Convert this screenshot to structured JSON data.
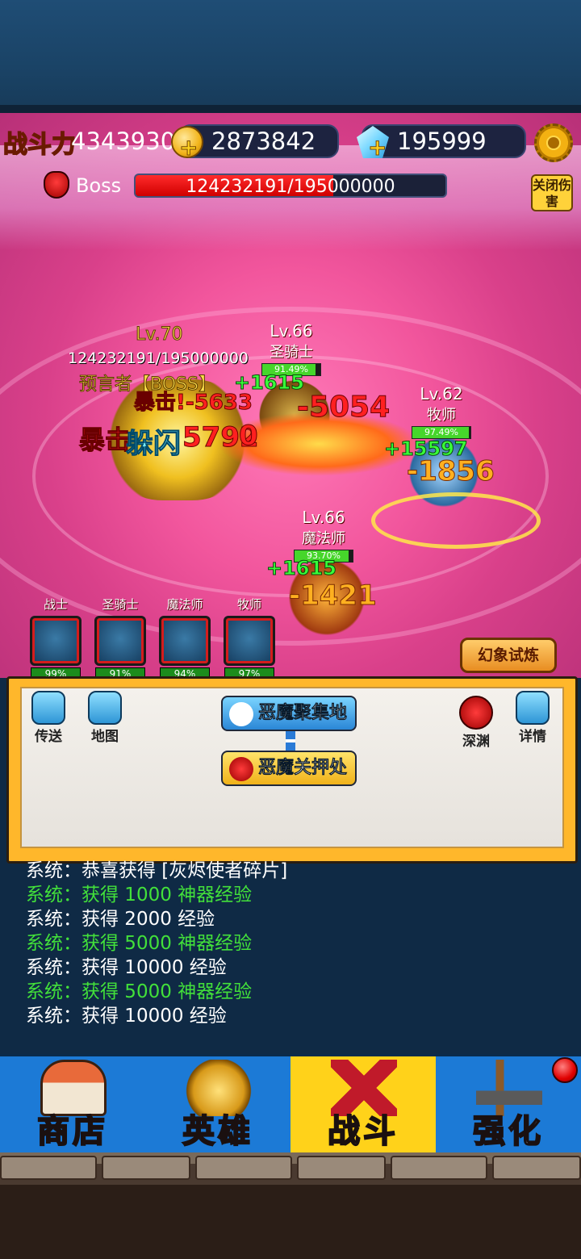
{
  "header": {
    "power_label": "战斗力",
    "power_value": "4343930",
    "gold": "2873842",
    "gems": "195999",
    "plus_glyph": "+",
    "gear_icon": "gear-icon"
  },
  "boss_bar": {
    "label": "Boss",
    "hp_text": "124232191/195000000",
    "hp_fraction": 0.637,
    "close_damage_label": "关闭伤害"
  },
  "battle": {
    "boss": {
      "level": "Lv.70",
      "hp_text": "124232191/195000000",
      "name": "预言者【BOSS】"
    },
    "units": [
      {
        "level": "Lv.66",
        "class": "圣骑士",
        "hp_pct": "91.49%",
        "hp_fraction": 0.9149
      },
      {
        "level": "Lv.62",
        "class": "牧师",
        "hp_pct": "97.49%",
        "hp_fraction": 0.9749
      },
      {
        "level": "Lv.66",
        "class": "魔法师",
        "hp_pct": "93.70%",
        "hp_fraction": 0.937
      }
    ],
    "floating_texts": {
      "crit1": "暴击!-5633",
      "big_red": "-5054",
      "heal1": "+1615",
      "dodge": "躲闪",
      "crit2": "暴击",
      "num2": "5792",
      "num3": "0",
      "heal2": "+15597",
      "orange1": "-1856",
      "heal3": "+1615",
      "orange2": "-1421"
    }
  },
  "party": [
    {
      "name": "战士",
      "pct": "99%"
    },
    {
      "name": "圣骑士",
      "pct": "91%"
    },
    {
      "name": "魔法师",
      "pct": "94%"
    },
    {
      "name": "牧师",
      "pct": "97%"
    }
  ],
  "illusion_button": "幻象试炼",
  "map": {
    "teleport": "传送",
    "map": "地图",
    "abyss": "深渊",
    "details": "详情",
    "node1": "恶魔聚集地",
    "node2": "恶魔关押处"
  },
  "log": [
    {
      "text": "系统：恭喜获得 [灰烬使者碎片]",
      "green": false
    },
    {
      "text": "系统：获得 1000 神器经验",
      "green": true
    },
    {
      "text": "系统：获得 2000 经验",
      "green": false
    },
    {
      "text": "系统：获得 5000 神器经验",
      "green": true
    },
    {
      "text": "系统：获得 10000 经验",
      "green": false
    },
    {
      "text": "系统：获得 5000 神器经验",
      "green": true
    },
    {
      "text": "系统：获得 10000 经验",
      "green": false
    }
  ],
  "nav": {
    "shop": "商店",
    "hero": "英雄",
    "battle": "战斗",
    "upgrade": "强化"
  },
  "colors": {
    "accent": "#ffd21a",
    "nav_blue": "#1c7ad6",
    "hp_red": "#ff2b2b",
    "log_green": "#42e03a"
  }
}
